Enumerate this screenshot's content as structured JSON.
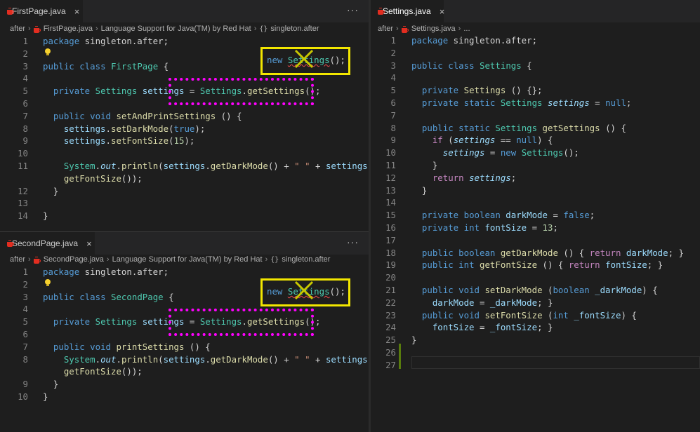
{
  "panes": {
    "first": {
      "tab": {
        "label": "FirstPage.java",
        "close": "×",
        "more": "···"
      },
      "breadcrumb": [
        "after",
        "FirstPage.java",
        "Language Support for Java(TM) by Red Hat",
        "singleton.after"
      ],
      "annotation_text_new": "new",
      "annotation_text_settings": "Settings",
      "annotation_text_paren": "();"
    },
    "second": {
      "tab": {
        "label": "SecondPage.java",
        "close": "×",
        "more": "···"
      },
      "breadcrumb": [
        "after",
        "SecondPage.java",
        "Language Support for Java(TM) by Red Hat",
        "singleton.after"
      ],
      "annotation_text_new": "new",
      "annotation_text_settings": "Settings",
      "annotation_text_paren": "();"
    },
    "settings": {
      "tab": {
        "label": "Settings.java",
        "close": "×"
      },
      "breadcrumb": [
        "after",
        "Settings.java",
        "..."
      ]
    }
  },
  "code": {
    "first": [
      {
        "n": "1",
        "t": [
          [
            "kw",
            "package"
          ],
          [
            "pl",
            " singleton.after;"
          ]
        ]
      },
      {
        "n": "2",
        "t": []
      },
      {
        "n": "3",
        "t": [
          [
            "kw",
            "public"
          ],
          [
            "pl",
            " "
          ],
          [
            "kw",
            "class"
          ],
          [
            "pl",
            " "
          ],
          [
            "cl",
            "FirstPage"
          ],
          [
            "pl",
            " {"
          ]
        ]
      },
      {
        "n": "4",
        "t": []
      },
      {
        "n": "5",
        "t": [
          [
            "pl",
            "  "
          ],
          [
            "kw",
            "private"
          ],
          [
            "pl",
            " "
          ],
          [
            "cl",
            "Settings"
          ],
          [
            "pl",
            " "
          ],
          [
            "vr",
            "settings"
          ],
          [
            "pl",
            " = "
          ],
          [
            "cl",
            "Settings"
          ],
          [
            "pl",
            "."
          ],
          [
            "fn",
            "getSettings"
          ],
          [
            "pl",
            "();"
          ]
        ]
      },
      {
        "n": "6",
        "t": []
      },
      {
        "n": "7",
        "t": [
          [
            "pl",
            "  "
          ],
          [
            "kw",
            "public"
          ],
          [
            "pl",
            " "
          ],
          [
            "kw",
            "void"
          ],
          [
            "pl",
            " "
          ],
          [
            "fn",
            "setAndPrintSettings"
          ],
          [
            "pl",
            " () {"
          ]
        ]
      },
      {
        "n": "8",
        "t": [
          [
            "pl",
            "    "
          ],
          [
            "vr",
            "settings"
          ],
          [
            "pl",
            "."
          ],
          [
            "fn",
            "setDarkMode"
          ],
          [
            "pl",
            "("
          ],
          [
            "kw",
            "true"
          ],
          [
            "pl",
            ");"
          ]
        ]
      },
      {
        "n": "9",
        "t": [
          [
            "pl",
            "    "
          ],
          [
            "vr",
            "settings"
          ],
          [
            "pl",
            "."
          ],
          [
            "fn",
            "setFontSize"
          ],
          [
            "pl",
            "("
          ],
          [
            "nu",
            "15"
          ],
          [
            "pl",
            ");"
          ]
        ]
      },
      {
        "n": "10",
        "t": []
      },
      {
        "n": "11",
        "t": [
          [
            "pl",
            "    "
          ],
          [
            "cl",
            "System"
          ],
          [
            "pl",
            "."
          ],
          [
            "vi",
            "out"
          ],
          [
            "pl",
            "."
          ],
          [
            "fn",
            "println"
          ],
          [
            "pl",
            "("
          ],
          [
            "vr",
            "settings"
          ],
          [
            "pl",
            "."
          ],
          [
            "fn",
            "getDarkMode"
          ],
          [
            "pl",
            "() + "
          ],
          [
            "st",
            "\" \""
          ],
          [
            "pl",
            " + "
          ],
          [
            "vr",
            "settings"
          ],
          [
            "pl",
            "."
          ]
        ]
      },
      {
        "n": "",
        "t": [
          [
            "pl",
            "    "
          ],
          [
            "fn",
            "getFontSize"
          ],
          [
            "pl",
            "());"
          ]
        ]
      },
      {
        "n": "12",
        "t": [
          [
            "pl",
            "  }"
          ]
        ]
      },
      {
        "n": "13",
        "t": []
      },
      {
        "n": "14",
        "t": [
          [
            "pl",
            "}"
          ]
        ]
      }
    ],
    "second": [
      {
        "n": "1",
        "t": [
          [
            "kw",
            "package"
          ],
          [
            "pl",
            " singleton.after;"
          ]
        ]
      },
      {
        "n": "2",
        "t": []
      },
      {
        "n": "3",
        "t": [
          [
            "kw",
            "public"
          ],
          [
            "pl",
            " "
          ],
          [
            "kw",
            "class"
          ],
          [
            "pl",
            " "
          ],
          [
            "cl",
            "SecondPage"
          ],
          [
            "pl",
            " {"
          ]
        ]
      },
      {
        "n": "4",
        "t": []
      },
      {
        "n": "5",
        "t": [
          [
            "pl",
            "  "
          ],
          [
            "kw",
            "private"
          ],
          [
            "pl",
            " "
          ],
          [
            "cl",
            "Settings"
          ],
          [
            "pl",
            " "
          ],
          [
            "vr",
            "settings"
          ],
          [
            "pl",
            " = "
          ],
          [
            "cl",
            "Settings"
          ],
          [
            "pl",
            "."
          ],
          [
            "fn",
            "getSettings"
          ],
          [
            "pl",
            "();"
          ]
        ]
      },
      {
        "n": "6",
        "t": []
      },
      {
        "n": "7",
        "t": [
          [
            "pl",
            "  "
          ],
          [
            "kw",
            "public"
          ],
          [
            "pl",
            " "
          ],
          [
            "kw",
            "void"
          ],
          [
            "pl",
            " "
          ],
          [
            "fn",
            "printSettings"
          ],
          [
            "pl",
            " () {"
          ]
        ]
      },
      {
        "n": "8",
        "t": [
          [
            "pl",
            "    "
          ],
          [
            "cl",
            "System"
          ],
          [
            "pl",
            "."
          ],
          [
            "vi",
            "out"
          ],
          [
            "pl",
            "."
          ],
          [
            "fn",
            "println"
          ],
          [
            "pl",
            "("
          ],
          [
            "vr",
            "settings"
          ],
          [
            "pl",
            "."
          ],
          [
            "fn",
            "getDarkMode"
          ],
          [
            "pl",
            "() + "
          ],
          [
            "st",
            "\" \""
          ],
          [
            "pl",
            " + "
          ],
          [
            "vr",
            "settings"
          ],
          [
            "pl",
            "."
          ]
        ]
      },
      {
        "n": "",
        "t": [
          [
            "pl",
            "    "
          ],
          [
            "fn",
            "getFontSize"
          ],
          [
            "pl",
            "());"
          ]
        ]
      },
      {
        "n": "9",
        "t": [
          [
            "pl",
            "  }"
          ]
        ]
      },
      {
        "n": "10",
        "t": [
          [
            "pl",
            "}"
          ]
        ]
      }
    ],
    "settings": [
      {
        "n": "1",
        "t": [
          [
            "kw",
            "package"
          ],
          [
            "pl",
            " singleton.after;"
          ]
        ]
      },
      {
        "n": "2",
        "t": []
      },
      {
        "n": "3",
        "t": [
          [
            "kw",
            "public"
          ],
          [
            "pl",
            " "
          ],
          [
            "kw",
            "class"
          ],
          [
            "pl",
            " "
          ],
          [
            "cl",
            "Settings"
          ],
          [
            "pl",
            " {"
          ]
        ]
      },
      {
        "n": "4",
        "t": []
      },
      {
        "n": "5",
        "t": [
          [
            "pl",
            "  "
          ],
          [
            "kw",
            "private"
          ],
          [
            "pl",
            " "
          ],
          [
            "fn",
            "Settings"
          ],
          [
            "pl",
            " () {};"
          ]
        ]
      },
      {
        "n": "6",
        "t": [
          [
            "pl",
            "  "
          ],
          [
            "kw",
            "private"
          ],
          [
            "pl",
            " "
          ],
          [
            "kw",
            "static"
          ],
          [
            "pl",
            " "
          ],
          [
            "cl",
            "Settings"
          ],
          [
            "pl",
            " "
          ],
          [
            "vi",
            "settings"
          ],
          [
            "pl",
            " = "
          ],
          [
            "kw",
            "null"
          ],
          [
            "pl",
            ";"
          ]
        ]
      },
      {
        "n": "7",
        "t": []
      },
      {
        "n": "8",
        "t": [
          [
            "pl",
            "  "
          ],
          [
            "kw",
            "public"
          ],
          [
            "pl",
            " "
          ],
          [
            "kw",
            "static"
          ],
          [
            "pl",
            " "
          ],
          [
            "cl",
            "Settings"
          ],
          [
            "pl",
            " "
          ],
          [
            "fn",
            "getSettings"
          ],
          [
            "pl",
            " () {"
          ]
        ]
      },
      {
        "n": "9",
        "t": [
          [
            "pl",
            "    "
          ],
          [
            "ctl",
            "if"
          ],
          [
            "pl",
            " ("
          ],
          [
            "vi",
            "settings"
          ],
          [
            "pl",
            " == "
          ],
          [
            "kw",
            "null"
          ],
          [
            "pl",
            ") {"
          ]
        ]
      },
      {
        "n": "10",
        "t": [
          [
            "pl",
            "      "
          ],
          [
            "vi",
            "settings"
          ],
          [
            "pl",
            " = "
          ],
          [
            "kw",
            "new"
          ],
          [
            "pl",
            " "
          ],
          [
            "cl",
            "Settings"
          ],
          [
            "pl",
            "();"
          ]
        ]
      },
      {
        "n": "11",
        "t": [
          [
            "pl",
            "    }"
          ]
        ]
      },
      {
        "n": "12",
        "t": [
          [
            "pl",
            "    "
          ],
          [
            "ctl",
            "return"
          ],
          [
            "pl",
            " "
          ],
          [
            "vi",
            "settings"
          ],
          [
            "pl",
            ";"
          ]
        ]
      },
      {
        "n": "13",
        "t": [
          [
            "pl",
            "  }"
          ]
        ]
      },
      {
        "n": "14",
        "t": []
      },
      {
        "n": "15",
        "t": [
          [
            "pl",
            "  "
          ],
          [
            "kw",
            "private"
          ],
          [
            "pl",
            " "
          ],
          [
            "kw",
            "boolean"
          ],
          [
            "pl",
            " "
          ],
          [
            "vr",
            "darkMode"
          ],
          [
            "pl",
            " = "
          ],
          [
            "kw",
            "false"
          ],
          [
            "pl",
            ";"
          ]
        ]
      },
      {
        "n": "16",
        "t": [
          [
            "pl",
            "  "
          ],
          [
            "kw",
            "private"
          ],
          [
            "pl",
            " "
          ],
          [
            "kw",
            "int"
          ],
          [
            "pl",
            " "
          ],
          [
            "vr",
            "fontSize"
          ],
          [
            "pl",
            " = "
          ],
          [
            "nu",
            "13"
          ],
          [
            "pl",
            ";"
          ]
        ]
      },
      {
        "n": "17",
        "t": []
      },
      {
        "n": "18",
        "t": [
          [
            "pl",
            "  "
          ],
          [
            "kw",
            "public"
          ],
          [
            "pl",
            " "
          ],
          [
            "kw",
            "boolean"
          ],
          [
            "pl",
            " "
          ],
          [
            "fn",
            "getDarkMode"
          ],
          [
            "pl",
            " () { "
          ],
          [
            "ctl",
            "return"
          ],
          [
            "pl",
            " "
          ],
          [
            "vr",
            "darkMode"
          ],
          [
            "pl",
            "; }"
          ]
        ]
      },
      {
        "n": "19",
        "t": [
          [
            "pl",
            "  "
          ],
          [
            "kw",
            "public"
          ],
          [
            "pl",
            " "
          ],
          [
            "kw",
            "int"
          ],
          [
            "pl",
            " "
          ],
          [
            "fn",
            "getFontSize"
          ],
          [
            "pl",
            " () { "
          ],
          [
            "ctl",
            "return"
          ],
          [
            "pl",
            " "
          ],
          [
            "vr",
            "fontSize"
          ],
          [
            "pl",
            "; }"
          ]
        ]
      },
      {
        "n": "20",
        "t": []
      },
      {
        "n": "21",
        "t": [
          [
            "pl",
            "  "
          ],
          [
            "kw",
            "public"
          ],
          [
            "pl",
            " "
          ],
          [
            "kw",
            "void"
          ],
          [
            "pl",
            " "
          ],
          [
            "fn",
            "setDarkMode"
          ],
          [
            "pl",
            " ("
          ],
          [
            "kw",
            "boolean"
          ],
          [
            "pl",
            " "
          ],
          [
            "vr",
            "_darkMode"
          ],
          [
            "pl",
            ") {"
          ]
        ]
      },
      {
        "n": "22",
        "t": [
          [
            "pl",
            "    "
          ],
          [
            "vr",
            "darkMode"
          ],
          [
            "pl",
            " = "
          ],
          [
            "vr",
            "_darkMode"
          ],
          [
            "pl",
            "; }"
          ]
        ]
      },
      {
        "n": "23",
        "t": [
          [
            "pl",
            "  "
          ],
          [
            "kw",
            "public"
          ],
          [
            "pl",
            " "
          ],
          [
            "kw",
            "void"
          ],
          [
            "pl",
            " "
          ],
          [
            "fn",
            "setFontSize"
          ],
          [
            "pl",
            " ("
          ],
          [
            "kw",
            "int"
          ],
          [
            "pl",
            " "
          ],
          [
            "vr",
            "_fontSize"
          ],
          [
            "pl",
            ") {"
          ]
        ]
      },
      {
        "n": "24",
        "t": [
          [
            "pl",
            "    "
          ],
          [
            "vr",
            "fontSize"
          ],
          [
            "pl",
            " = "
          ],
          [
            "vr",
            "_fontSize"
          ],
          [
            "pl",
            "; }"
          ]
        ]
      },
      {
        "n": "25",
        "t": [
          [
            "pl",
            "}"
          ]
        ]
      },
      {
        "n": "26",
        "t": []
      },
      {
        "n": "27",
        "t": []
      }
    ]
  },
  "colors": {
    "background": "#1e1e1e",
    "annotation_box": "#f2e600",
    "annotation_dotted": "#ff00ff",
    "keyword": "#569cd6",
    "class": "#4ec9b0",
    "method": "#dcdcaa",
    "variable": "#9cdcfe"
  }
}
